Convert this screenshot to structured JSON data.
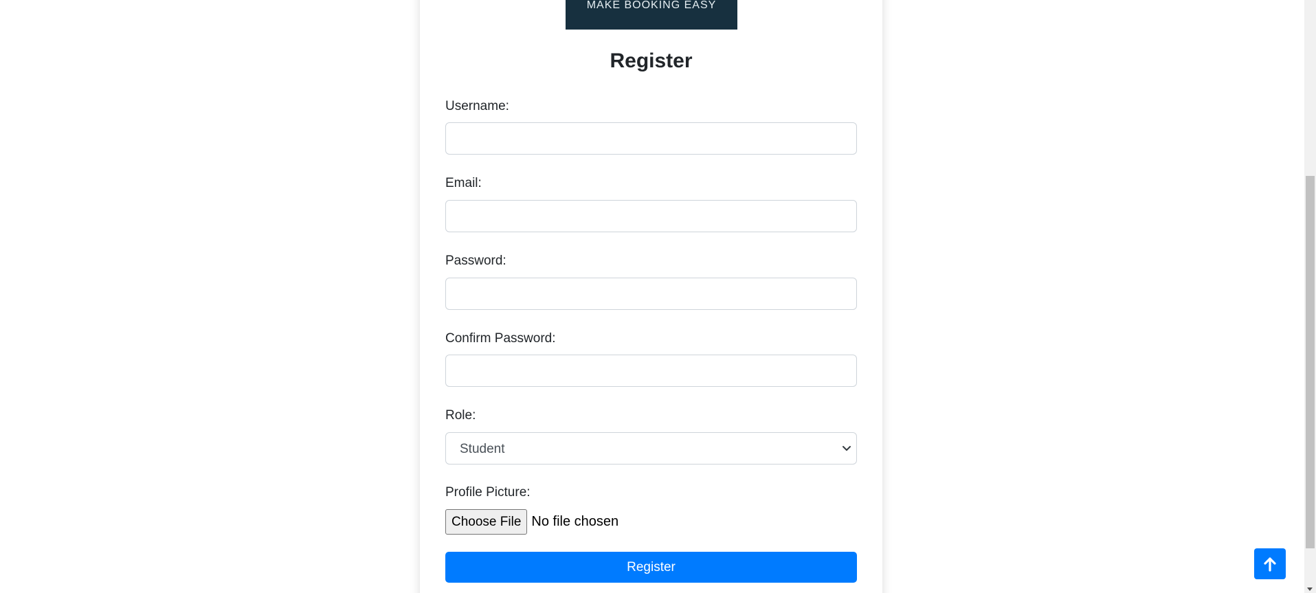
{
  "logo": {
    "tagline": "MAKE BOOKING EASY"
  },
  "form": {
    "title": "Register",
    "fields": {
      "username": {
        "label": "Username:",
        "value": ""
      },
      "email": {
        "label": "Email:",
        "value": ""
      },
      "password": {
        "label": "Password:",
        "value": ""
      },
      "confirm_password": {
        "label": "Confirm Password:",
        "value": ""
      }
    },
    "role": {
      "label": "Role:",
      "selected": "Student"
    },
    "profile_picture": {
      "label": "Profile Picture:",
      "button_label": "Choose File",
      "status": "No file chosen"
    },
    "submit_label": "Register"
  },
  "colors": {
    "primary": "#007bff",
    "banner": "#17303f"
  },
  "icons": {
    "back_to_top": "arrow-up-icon",
    "select_chevron": "chevron-down-icon"
  }
}
